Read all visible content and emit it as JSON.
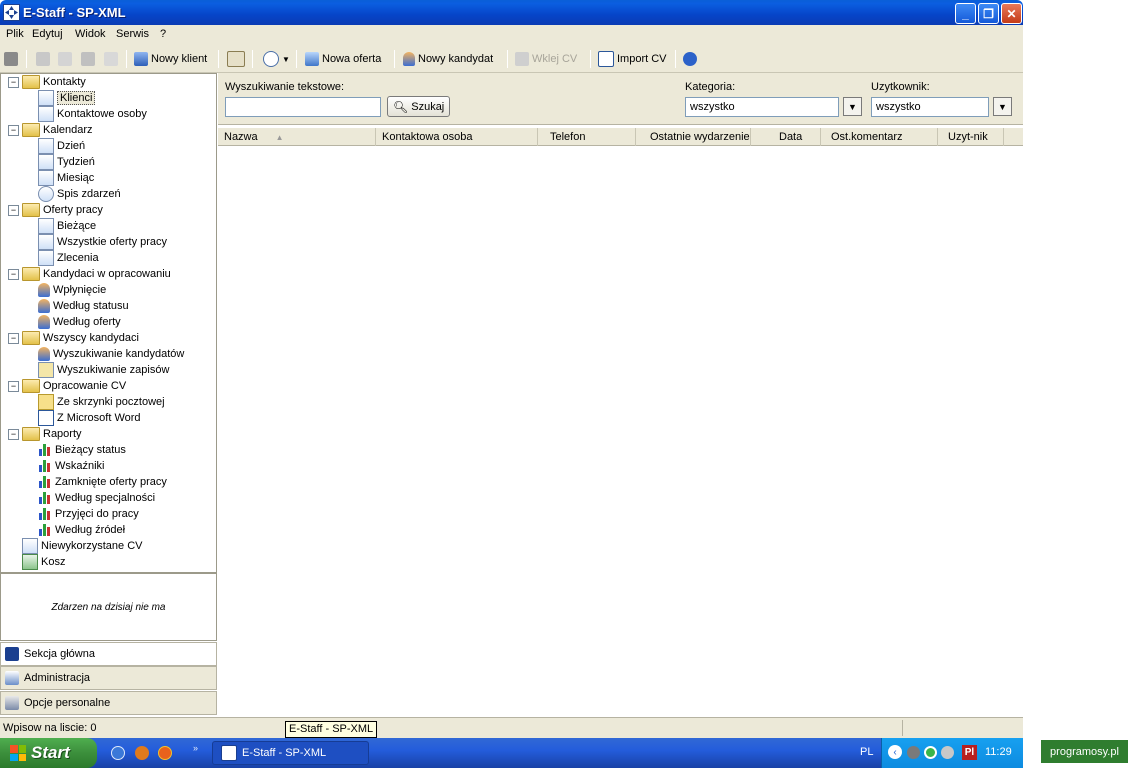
{
  "window": {
    "title": "E-Staff - SP-XML"
  },
  "menu": [
    "Plik",
    "Edytuj",
    "Widok",
    "Serwis",
    "?"
  ],
  "toolbar": {
    "new_client": "Nowy klient",
    "new_offer": "Nowa oferta",
    "new_candidate": "Nowy kandydat",
    "paste_cv": "Wklej CV",
    "import_cv": "Import CV"
  },
  "tree": {
    "contacts": "Kontakty",
    "clients": "Klienci",
    "contact_persons": "Kontaktowe osoby",
    "calendar": "Kalendarz",
    "day": "Dzień",
    "week": "Tydzień",
    "month": "Miesiąc",
    "events_list": "Spis zdarzeń",
    "job_offers": "Oferty pracy",
    "current": "Bieżące",
    "all_offers": "Wszystkie oferty pracy",
    "orders": "Zlecenia",
    "candidates_processing": "Kandydaci w opracowaniu",
    "inflow": "Wpłynięcie",
    "by_status": "Według statusu",
    "by_offer": "Według oferty",
    "all_candidates": "Wszyscy kandydaci",
    "search_candidates": "Wyszukiwanie kandydatów",
    "search_records": "Wyszukiwanie zapisów",
    "cv_processing": "Opracowanie CV",
    "from_mailbox": "Ze skrzynki pocztowej",
    "from_word": "Z Microsoft Word",
    "reports": "Raporty",
    "current_status": "Bieżący status",
    "indicators": "Wskaźniki",
    "closed_offers": "Zamknięte oferty pracy",
    "by_specialty": "Według specjalności",
    "hired": "Przyjęci do pracy",
    "by_sources": "Według źródeł",
    "unused_cv": "Niewykorzystane CV",
    "trash": "Kosz"
  },
  "events_today": "Zdarzen na dzisiaj nie ma",
  "nav": {
    "main_section": "Sekcja główna",
    "administration": "Administracja",
    "personal_options": "Opcje personalne"
  },
  "search": {
    "text_label": "Wyszukiwanie tekstowe:",
    "text_value": "",
    "button": "Szukaj",
    "category_label": "Kategoria:",
    "category_value": "wszystko",
    "user_label": "Uzytkownik:",
    "user_value": "wszystko"
  },
  "columns": [
    "Nazwa",
    "Kontaktowa osoba",
    "Telefon",
    "Ostatnie wydarzenie",
    "Data",
    "Ost.komentarz",
    "Uzyt-nik"
  ],
  "status": {
    "records": "Wpisow na liscie: 0",
    "tooltip": "E-Staff - SP-XML"
  },
  "taskbar": {
    "start": "Start",
    "task": "E-Staff - SP-XML",
    "lang": "PL",
    "time": "11:29",
    "lang_badge": "Pl"
  },
  "watermark": "programosy.pl",
  "colors": {
    "titlebar": "#0a5fd8",
    "start": "#3c8f3c",
    "taskbar": "#245ddb",
    "panel": "#ece9d8"
  }
}
